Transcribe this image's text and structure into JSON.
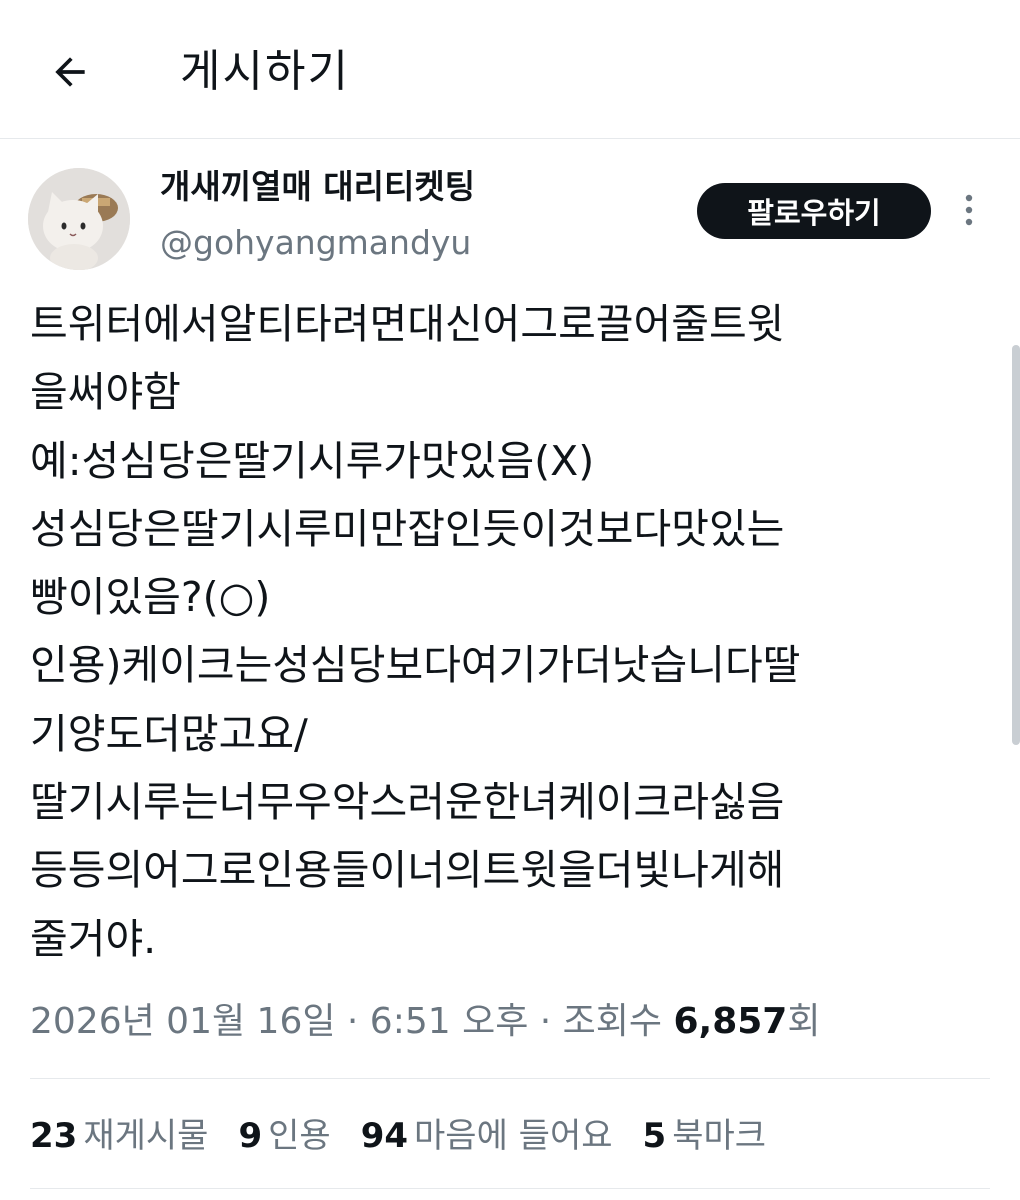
{
  "topbar": {
    "title": "게시하기",
    "back_icon": "arrow-left-icon"
  },
  "author": {
    "display_name": "개새끼열매 대리티켓팅",
    "handle": "@gohyangmandyu",
    "avatar": "cat-plush-avatar"
  },
  "actions": {
    "follow_label": "팔로우하기",
    "more_icon": "more-vertical-icon"
  },
  "tweet": {
    "lines": [
      "트위터에서알티타려면대신어그로끌어줄트윗",
      "을써야함",
      "예:성심당은딸기시루가맛있음(X)",
      "성심당은딸기시루미만잡인듯이것보다맛있는",
      "빵이있음?(○)",
      "인용)케이크는성심당보다여기가더낫습니다딸",
      "기양도더많고요/",
      "딸기시루는너무우악스러운한녀케이크라싫음",
      "등등의어그로인용들이너의트윗을더빛나게해",
      "줄거야."
    ]
  },
  "meta": {
    "timestamp": "2026년 01월 16일 · 6:51 오후 · 조회수 ",
    "views_count": "6,857",
    "views_suffix": "회"
  },
  "stats": {
    "retweets_count": "23",
    "retweets_label": "재게시물",
    "quotes_count": "9",
    "quotes_label": "인용",
    "likes_count": "94",
    "likes_label": "마음에 들어요",
    "bookmarks_count": "5",
    "bookmarks_label": "북마크"
  },
  "colors": {
    "text": "#0f1419",
    "secondary": "#6b7680",
    "divider": "#e6e9ec",
    "button": "#0f1419"
  }
}
